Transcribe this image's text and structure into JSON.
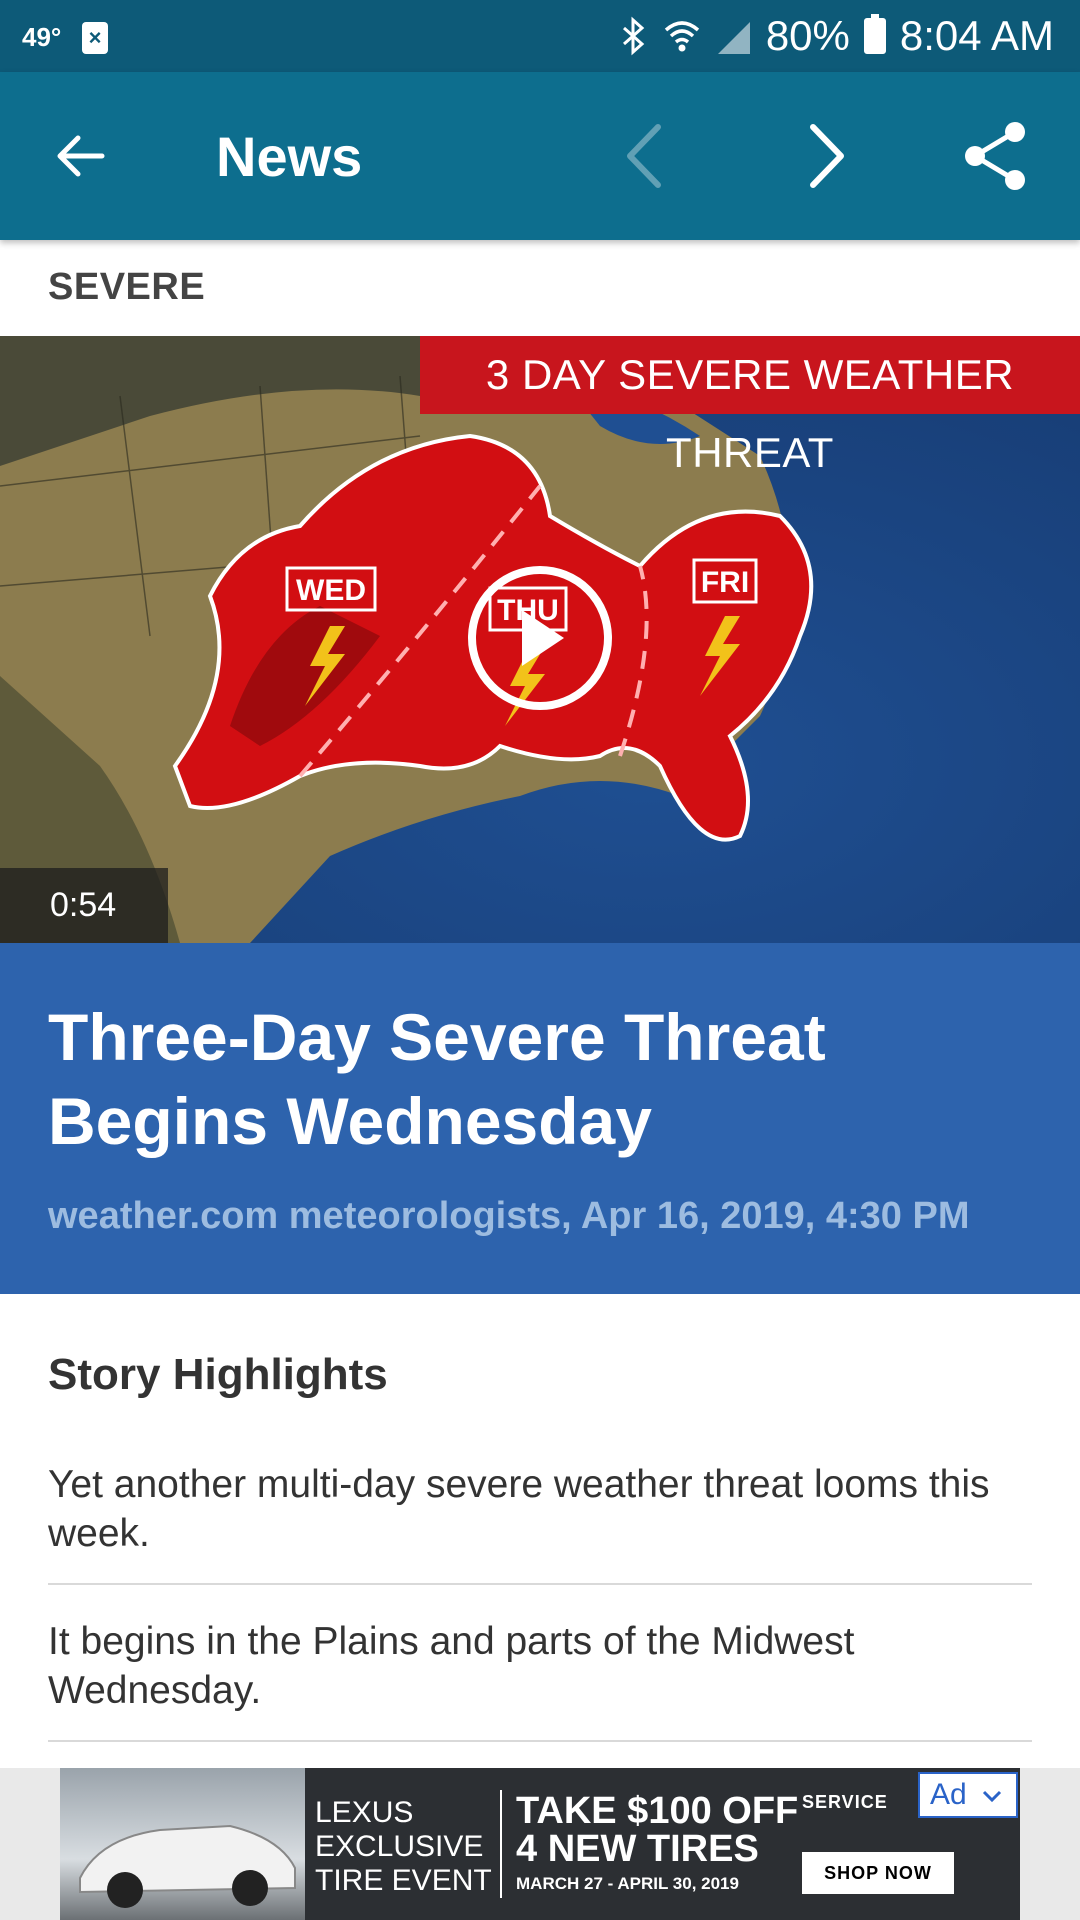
{
  "status_bar": {
    "temperature": "49°",
    "battery": "80%",
    "time": "8:04 AM"
  },
  "app_bar": {
    "title": "News"
  },
  "category": "SEVERE",
  "video": {
    "banner": "3 DAY SEVERE WEATHER THREAT",
    "labels": [
      "WED",
      "THU",
      "FRI"
    ],
    "duration": "0:54"
  },
  "article": {
    "headline": "Three-Day Severe Threat Begins Wednesday",
    "byline": "weather.com meteorologists, Apr 16, 2019, 4:30 PM"
  },
  "highlights": {
    "title": "Story Highlights",
    "items": [
      "Yet another multi-day severe weather threat looms this week.",
      "It begins in the Plains and parts of the Midwest Wednesday."
    ]
  },
  "ad": {
    "badge": "Ad",
    "brand_lines": [
      "LEXUS",
      "EXCLUSIVE",
      "TIRE EVENT"
    ],
    "offer_lines": [
      "TAKE $100 OFF",
      "4 NEW TIRES"
    ],
    "dates": "MARCH 27 - APRIL 30, 2019",
    "service": "SERVICE",
    "cta": "SHOP NOW"
  },
  "colors": {
    "status_bar": "#0d5a78",
    "app_bar": "#0d6e8e",
    "headline_panel": "#2d63ad",
    "banner": "#c8151d"
  }
}
